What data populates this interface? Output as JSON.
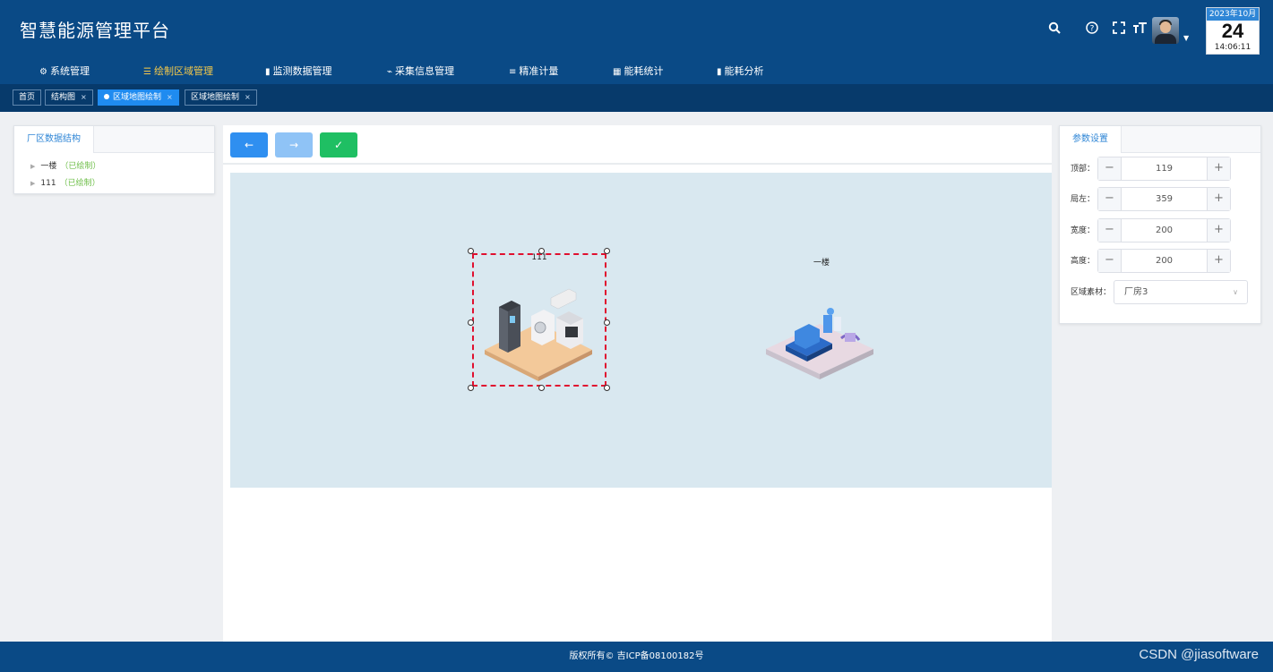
{
  "header": {
    "title": "智慧能源管理平台",
    "icons": [
      "search-icon",
      "help-icon",
      "fullscreen-icon",
      "font-size-icon"
    ],
    "calendar": {
      "month": "2023年10月",
      "day": "24",
      "time": "14:06:11"
    }
  },
  "nav": {
    "items": [
      {
        "label": "系统管理",
        "icon": "gear-icon"
      },
      {
        "label": "绘制区域管理",
        "icon": "list-icon",
        "active": true
      },
      {
        "label": "监测数据管理",
        "icon": "bar-chart-icon"
      },
      {
        "label": "采集信息管理",
        "icon": "plug-icon"
      },
      {
        "label": "精准计量",
        "icon": "sliders-icon"
      },
      {
        "label": "能耗统计",
        "icon": "table-icon"
      },
      {
        "label": "能耗分析",
        "icon": "bar-chart-icon"
      }
    ]
  },
  "tabs": [
    {
      "label": "首页",
      "closable": false
    },
    {
      "label": "结构图",
      "closable": true
    },
    {
      "label": "区域地图绘制",
      "closable": true,
      "active": true
    },
    {
      "label": "区域地图绘制",
      "closable": true
    }
  ],
  "tab_close_glyph": "×",
  "left_panel": {
    "tab": "厂区数据结构",
    "tree": [
      {
        "name": "一楼",
        "status": "（已绘制）"
      },
      {
        "name": "111",
        "status": "（已绘制）"
      }
    ]
  },
  "toolbar": {
    "back_glyph": "←",
    "forward_glyph": "→",
    "confirm_glyph": "✓"
  },
  "canvas": {
    "areas": [
      {
        "label": "111",
        "selected": true
      },
      {
        "label": "一楼",
        "selected": false
      }
    ]
  },
  "right_panel": {
    "tab": "参数设置",
    "fields": [
      {
        "label": "顶部：",
        "value": "119"
      },
      {
        "label": "局左：",
        "value": "359"
      },
      {
        "label": "宽度：",
        "value": "200"
      },
      {
        "label": "高度：",
        "value": "200"
      }
    ],
    "material": {
      "label": "区域素材：",
      "value": "厂房3"
    }
  },
  "footer": {
    "copyright": "版权所有© 吉ICP备08100182号",
    "watermark": "CSDN @jiasoftware"
  },
  "colors": {
    "header_bg": "#0a4a86",
    "tabs_bg": "#073a6b",
    "active_nav": "#f5c94a",
    "primary": "#2f8ff0",
    "success": "#1fbf63",
    "selection": "#e0102f",
    "canvas_bg": "#d9e8f0"
  }
}
